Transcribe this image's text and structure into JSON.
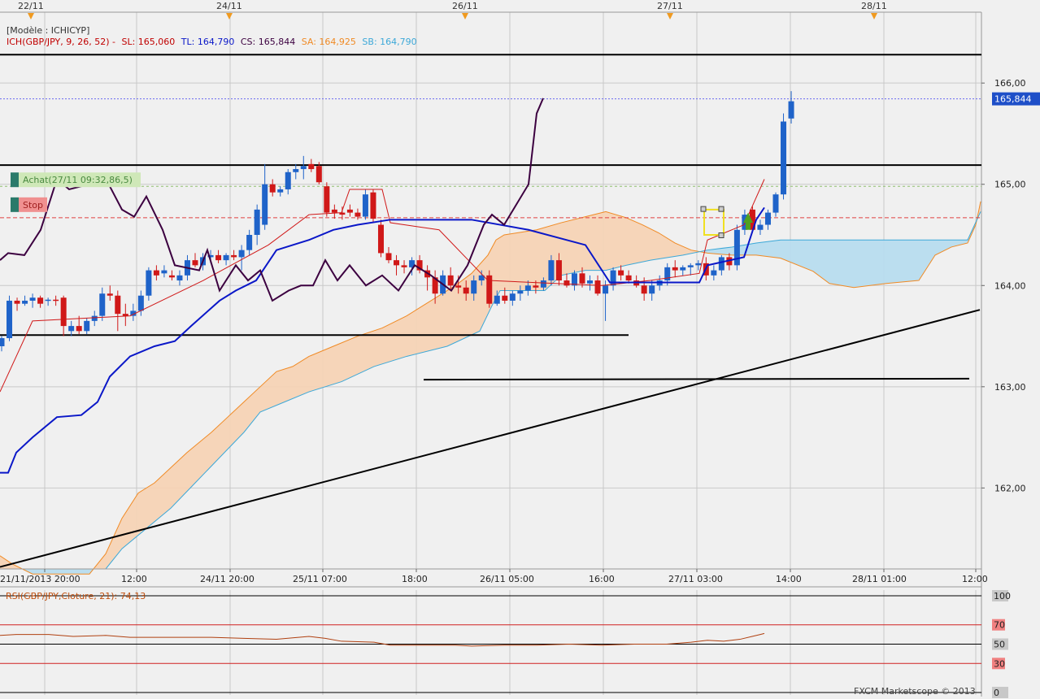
{
  "header": {
    "model_label": "[Modèle : ICHICYP]",
    "ichimoku": "ICH(GBP/JPY, 9, 26, 52) -",
    "sl": "SL: 165,060",
    "tl": "TL: 164,790",
    "cs": "CS: 165,844",
    "sa": "SA: 164,925",
    "sb": "SB: 164,790"
  },
  "colors": {
    "background": "#f0f0f0",
    "grid": "#c9c9c9",
    "bull_candle": "#1f63c9",
    "bear_candle": "#d01818",
    "tenkan": "#d01818",
    "kijun": "#0a17c8",
    "chikou": "#3c0040",
    "senkou_a": "#f08a24",
    "senkou_b": "#3ca8d8",
    "cloud_bull": "#b7dcee",
    "cloud_bear": "#f6d3b5",
    "price_label_bg": "#1e4fc8"
  },
  "top_dates": [
    "22/11",
    "24/11",
    "26/11",
    "27/11",
    "28/11"
  ],
  "orders": {
    "achat_label": "Achat(27/11 09:32,86,5)",
    "stop_label": "Stop"
  },
  "current_price": "165,844",
  "rsi": {
    "label": "RSI(GBP/JPY,Cloture, 21): 74,13",
    "value": 74.13,
    "levels": [
      "100",
      "70",
      "50",
      "30",
      "0"
    ]
  },
  "footer": "FXCM Marketscope © 2013",
  "chart_data": {
    "type": "candlestick",
    "symbol": "GBP/JPY",
    "x_tick_labels": [
      "21/11/2013 20:00",
      "12:00",
      "24/11 20:00",
      "25/11 07:00",
      "18:00",
      "26/11 05:00",
      "16:00",
      "27/11 03:00",
      "14:00",
      "28/11 01:00",
      "12:00"
    ],
    "y_tick_labels": [
      "166,00",
      "165,00",
      "164,00",
      "163,00",
      "162,00"
    ],
    "ylim": [
      161.2,
      166.7
    ],
    "resistance_lines": [
      166.28,
      165.19,
      163.51
    ],
    "horizontal_line_lower": 163.07,
    "trendline": {
      "from": [
        0,
        161.22
      ],
      "to": [
        1205,
        163.76
      ]
    },
    "price_line": 165.844,
    "achat_level": 164.98,
    "stop_level": 164.67,
    "candles": [
      [
        163.4,
        163.5,
        163.35,
        163.48
      ],
      [
        163.48,
        163.9,
        163.45,
        163.85
      ],
      [
        163.85,
        163.88,
        163.75,
        163.82
      ],
      [
        163.82,
        163.9,
        163.8,
        163.85
      ],
      [
        163.85,
        163.92,
        163.78,
        163.88
      ],
      [
        163.88,
        163.9,
        163.78,
        163.82
      ],
      [
        163.85,
        163.88,
        163.8,
        163.86
      ],
      [
        163.86,
        163.9,
        163.8,
        163.85
      ],
      [
        163.88,
        163.9,
        163.5,
        163.6
      ],
      [
        163.55,
        163.65,
        163.5,
        163.6
      ],
      [
        163.6,
        163.7,
        163.52,
        163.55
      ],
      [
        163.55,
        163.68,
        163.52,
        163.65
      ],
      [
        163.65,
        163.75,
        163.6,
        163.7
      ],
      [
        163.7,
        163.98,
        163.65,
        163.92
      ],
      [
        163.92,
        164.0,
        163.85,
        163.9
      ],
      [
        163.9,
        163.95,
        163.55,
        163.72
      ],
      [
        163.72,
        163.82,
        163.6,
        163.7
      ],
      [
        163.7,
        163.82,
        163.65,
        163.75
      ],
      [
        163.75,
        163.95,
        163.7,
        163.9
      ],
      [
        163.9,
        164.18,
        163.85,
        164.15
      ],
      [
        164.15,
        164.2,
        164.05,
        164.1
      ],
      [
        164.12,
        164.2,
        164.08,
        164.15
      ],
      [
        164.1,
        164.15,
        164.05,
        164.08
      ],
      [
        164.05,
        164.15,
        164.0,
        164.1
      ],
      [
        164.1,
        164.3,
        164.05,
        164.25
      ],
      [
        164.25,
        164.32,
        164.18,
        164.2
      ],
      [
        164.2,
        164.32,
        164.15,
        164.28
      ],
      [
        164.28,
        164.35,
        164.22,
        164.3
      ],
      [
        164.3,
        164.35,
        164.22,
        164.25
      ],
      [
        164.25,
        164.32,
        164.2,
        164.3
      ],
      [
        164.3,
        164.35,
        164.25,
        164.28
      ],
      [
        164.28,
        164.4,
        164.15,
        164.35
      ],
      [
        164.35,
        164.55,
        164.3,
        164.5
      ],
      [
        164.5,
        164.8,
        164.4,
        164.75
      ],
      [
        164.6,
        165.2,
        164.55,
        165.0
      ],
      [
        165.0,
        165.05,
        164.88,
        164.92
      ],
      [
        164.92,
        164.98,
        164.88,
        164.95
      ],
      [
        164.95,
        165.15,
        164.9,
        165.12
      ],
      [
        165.12,
        165.2,
        165.05,
        165.15
      ],
      [
        165.15,
        165.28,
        165.05,
        165.18
      ],
      [
        165.2,
        165.25,
        165.12,
        165.15
      ],
      [
        165.18,
        165.22,
        165.0,
        165.02
      ],
      [
        164.98,
        165.02,
        164.68,
        164.72
      ],
      [
        164.75,
        164.8,
        164.66,
        164.72
      ],
      [
        164.72,
        164.78,
        164.65,
        164.7
      ],
      [
        164.75,
        164.8,
        164.68,
        164.72
      ],
      [
        164.72,
        164.76,
        164.65,
        164.68
      ],
      [
        164.68,
        164.95,
        164.65,
        164.9
      ],
      [
        164.92,
        164.95,
        164.62,
        164.66
      ],
      [
        164.6,
        164.65,
        164.28,
        164.32
      ],
      [
        164.32,
        164.38,
        164.22,
        164.25
      ],
      [
        164.25,
        164.3,
        164.1,
        164.2
      ],
      [
        164.2,
        164.25,
        164.12,
        164.18
      ],
      [
        164.18,
        164.28,
        164.1,
        164.25
      ],
      [
        164.25,
        164.3,
        164.12,
        164.15
      ],
      [
        164.15,
        164.2,
        163.95,
        164.08
      ],
      [
        164.08,
        164.15,
        163.82,
        163.92
      ],
      [
        163.92,
        164.15,
        163.9,
        164.1
      ],
      [
        164.1,
        164.18,
        163.95,
        164.0
      ],
      [
        164.0,
        164.1,
        163.92,
        163.98
      ],
      [
        163.98,
        164.05,
        163.85,
        163.92
      ],
      [
        163.92,
        164.1,
        163.85,
        164.05
      ],
      [
        164.05,
        164.15,
        164.0,
        164.1
      ],
      [
        164.1,
        164.15,
        163.78,
        163.82
      ],
      [
        163.82,
        163.95,
        163.8,
        163.9
      ],
      [
        163.9,
        163.98,
        163.82,
        163.85
      ],
      [
        163.85,
        163.95,
        163.8,
        163.92
      ],
      [
        163.92,
        164.0,
        163.85,
        163.95
      ],
      [
        163.95,
        164.05,
        163.9,
        164.0
      ],
      [
        164.0,
        164.05,
        163.92,
        163.98
      ],
      [
        163.98,
        164.08,
        163.95,
        164.05
      ],
      [
        164.05,
        164.3,
        164.0,
        164.25
      ],
      [
        164.25,
        164.32,
        164.0,
        164.05
      ],
      [
        164.05,
        164.12,
        163.98,
        164.0
      ],
      [
        164.0,
        164.15,
        163.95,
        164.12
      ],
      [
        164.12,
        164.18,
        163.98,
        164.02
      ],
      [
        164.02,
        164.1,
        163.95,
        164.05
      ],
      [
        164.05,
        164.1,
        163.9,
        163.92
      ],
      [
        163.92,
        164.05,
        163.65,
        164.0
      ],
      [
        164.0,
        164.18,
        163.95,
        164.15
      ],
      [
        164.15,
        164.2,
        164.05,
        164.1
      ],
      [
        164.1,
        164.15,
        164.02,
        164.05
      ],
      [
        164.05,
        164.1,
        163.98,
        164.0
      ],
      [
        164.0,
        164.08,
        163.85,
        163.92
      ],
      [
        163.92,
        164.05,
        163.85,
        164.0
      ],
      [
        164.0,
        164.1,
        163.95,
        164.05
      ],
      [
        164.05,
        164.22,
        164.0,
        164.18
      ],
      [
        164.18,
        164.25,
        164.08,
        164.15
      ],
      [
        164.15,
        164.2,
        164.1,
        164.18
      ],
      [
        164.18,
        164.22,
        164.1,
        164.2
      ],
      [
        164.2,
        164.25,
        164.15,
        164.22
      ],
      [
        164.22,
        164.28,
        164.05,
        164.1
      ],
      [
        164.1,
        164.2,
        164.05,
        164.15
      ],
      [
        164.15,
        164.3,
        164.1,
        164.28
      ],
      [
        164.28,
        164.32,
        164.15,
        164.2
      ],
      [
        164.2,
        164.6,
        164.15,
        164.55
      ],
      [
        164.55,
        164.75,
        164.5,
        164.7
      ],
      [
        164.75,
        164.78,
        164.52,
        164.55
      ],
      [
        164.55,
        164.65,
        164.5,
        164.6
      ],
      [
        164.6,
        164.75,
        164.55,
        164.72
      ],
      [
        164.72,
        164.92,
        164.68,
        164.9
      ],
      [
        164.9,
        165.7,
        164.85,
        165.62
      ],
      [
        165.65,
        165.92,
        165.6,
        165.82
      ]
    ],
    "tenkan": [
      [
        0,
        162.95
      ],
      [
        40,
        163.65
      ],
      [
        160,
        163.7
      ],
      [
        250,
        164.05
      ],
      [
        330,
        164.4
      ],
      [
        380,
        164.7
      ],
      [
        420,
        164.72
      ],
      [
        430,
        164.95
      ],
      [
        470,
        164.95
      ],
      [
        480,
        164.62
      ],
      [
        540,
        164.55
      ],
      [
        600,
        164.05
      ],
      [
        740,
        164.0
      ],
      [
        800,
        164.05
      ],
      [
        860,
        164.12
      ],
      [
        870,
        164.45
      ],
      [
        915,
        164.6
      ],
      [
        940,
        165.05
      ]
    ],
    "kijun": [
      [
        0,
        162.15
      ],
      [
        10,
        162.15
      ],
      [
        20,
        162.35
      ],
      [
        40,
        162.5
      ],
      [
        70,
        162.7
      ],
      [
        100,
        162.72
      ],
      [
        120,
        162.85
      ],
      [
        135,
        163.1
      ],
      [
        160,
        163.3
      ],
      [
        190,
        163.4
      ],
      [
        215,
        163.45
      ],
      [
        235,
        163.6
      ],
      [
        270,
        163.85
      ],
      [
        290,
        163.95
      ],
      [
        315,
        164.05
      ],
      [
        340,
        164.35
      ],
      [
        360,
        164.4
      ],
      [
        380,
        164.45
      ],
      [
        410,
        164.55
      ],
      [
        440,
        164.6
      ],
      [
        480,
        164.65
      ],
      [
        580,
        164.65
      ],
      [
        650,
        164.55
      ],
      [
        720,
        164.4
      ],
      [
        750,
        164.03
      ],
      [
        860,
        164.03
      ],
      [
        870,
        164.2
      ],
      [
        915,
        164.28
      ],
      [
        930,
        164.65
      ],
      [
        940,
        164.77
      ]
    ],
    "chikou": [
      [
        0,
        164.25
      ],
      [
        10,
        164.32
      ],
      [
        30,
        164.3
      ],
      [
        50,
        164.55
      ],
      [
        70,
        165.05
      ],
      [
        85,
        164.95
      ],
      [
        100,
        164.98
      ],
      [
        120,
        165.05
      ],
      [
        135,
        164.98
      ],
      [
        150,
        164.75
      ],
      [
        165,
        164.68
      ],
      [
        180,
        164.88
      ],
      [
        200,
        164.55
      ],
      [
        215,
        164.2
      ],
      [
        245,
        164.15
      ],
      [
        255,
        164.35
      ],
      [
        270,
        163.95
      ],
      [
        290,
        164.2
      ],
      [
        305,
        164.05
      ],
      [
        320,
        164.15
      ],
      [
        335,
        163.85
      ],
      [
        355,
        163.95
      ],
      [
        370,
        164.0
      ],
      [
        385,
        164.0
      ],
      [
        400,
        164.25
      ],
      [
        415,
        164.05
      ],
      [
        430,
        164.2
      ],
      [
        450,
        164.0
      ],
      [
        470,
        164.1
      ],
      [
        490,
        163.95
      ],
      [
        510,
        164.2
      ],
      [
        530,
        164.1
      ],
      [
        555,
        163.95
      ],
      [
        575,
        164.2
      ],
      [
        595,
        164.6
      ],
      [
        605,
        164.7
      ],
      [
        620,
        164.6
      ],
      [
        635,
        164.8
      ],
      [
        650,
        165.0
      ],
      [
        660,
        165.7
      ],
      [
        668,
        165.85
      ]
    ],
    "senkou_a": [
      [
        0,
        161.33
      ],
      [
        15,
        161.25
      ],
      [
        40,
        161.15
      ],
      [
        110,
        161.15
      ],
      [
        130,
        161.35
      ],
      [
        150,
        161.7
      ],
      [
        170,
        161.95
      ],
      [
        190,
        162.05
      ],
      [
        230,
        162.35
      ],
      [
        260,
        162.55
      ],
      [
        280,
        162.7
      ],
      [
        300,
        162.85
      ],
      [
        320,
        163.0
      ],
      [
        340,
        163.15
      ],
      [
        360,
        163.2
      ],
      [
        380,
        163.3
      ],
      [
        410,
        163.4
      ],
      [
        440,
        163.5
      ],
      [
        470,
        163.58
      ],
      [
        500,
        163.7
      ],
      [
        530,
        163.85
      ],
      [
        560,
        164.0
      ],
      [
        580,
        164.12
      ],
      [
        600,
        164.3
      ],
      [
        610,
        164.45
      ],
      [
        620,
        164.5
      ],
      [
        660,
        164.55
      ],
      [
        690,
        164.62
      ],
      [
        730,
        164.7
      ],
      [
        745,
        164.73
      ],
      [
        770,
        164.67
      ],
      [
        790,
        164.6
      ],
      [
        810,
        164.52
      ],
      [
        830,
        164.42
      ],
      [
        850,
        164.35
      ],
      [
        870,
        164.32
      ],
      [
        900,
        164.3
      ],
      [
        930,
        164.3
      ],
      [
        960,
        164.27
      ],
      [
        1000,
        164.14
      ],
      [
        1020,
        164.02
      ],
      [
        1050,
        163.98
      ],
      [
        1090,
        164.02
      ],
      [
        1130,
        164.05
      ],
      [
        1150,
        164.3
      ],
      [
        1170,
        164.38
      ],
      [
        1190,
        164.42
      ],
      [
        1200,
        164.6
      ],
      [
        1206,
        164.83
      ]
    ],
    "senkou_b": [
      [
        130,
        161.2
      ],
      [
        150,
        161.4
      ],
      [
        180,
        161.6
      ],
      [
        210,
        161.8
      ],
      [
        240,
        162.05
      ],
      [
        270,
        162.3
      ],
      [
        300,
        162.55
      ],
      [
        320,
        162.75
      ],
      [
        350,
        162.85
      ],
      [
        380,
        162.95
      ],
      [
        420,
        163.05
      ],
      [
        460,
        163.2
      ],
      [
        500,
        163.3
      ],
      [
        550,
        163.4
      ],
      [
        590,
        163.55
      ],
      [
        605,
        163.8
      ],
      [
        615,
        163.95
      ],
      [
        640,
        163.95
      ],
      [
        670,
        163.95
      ],
      [
        690,
        164.1
      ],
      [
        720,
        164.15
      ],
      [
        745,
        164.15
      ],
      [
        770,
        164.2
      ],
      [
        800,
        164.25
      ],
      [
        840,
        164.3
      ],
      [
        870,
        164.35
      ],
      [
        900,
        164.38
      ],
      [
        930,
        164.42
      ],
      [
        960,
        164.45
      ],
      [
        1000,
        164.45
      ],
      [
        1100,
        164.45
      ],
      [
        1190,
        164.45
      ],
      [
        1206,
        164.73
      ]
    ],
    "rsi_series": [
      [
        0,
        59
      ],
      [
        20,
        60
      ],
      [
        40,
        60
      ],
      [
        60,
        60
      ],
      [
        90,
        58
      ],
      [
        130,
        59
      ],
      [
        160,
        57
      ],
      [
        200,
        57
      ],
      [
        260,
        57
      ],
      [
        300,
        56
      ],
      [
        340,
        55
      ],
      [
        380,
        58
      ],
      [
        400,
        56
      ],
      [
        420,
        53
      ],
      [
        460,
        52
      ],
      [
        480,
        49
      ],
      [
        520,
        49
      ],
      [
        560,
        49
      ],
      [
        580,
        48
      ],
      [
        620,
        49
      ],
      [
        660,
        49
      ],
      [
        700,
        50
      ],
      [
        740,
        49
      ],
      [
        780,
        50
      ],
      [
        820,
        50
      ],
      [
        850,
        52
      ],
      [
        870,
        54
      ],
      [
        890,
        53
      ],
      [
        910,
        55
      ],
      [
        925,
        58
      ],
      [
        935,
        60
      ],
      [
        940,
        61
      ]
    ]
  }
}
